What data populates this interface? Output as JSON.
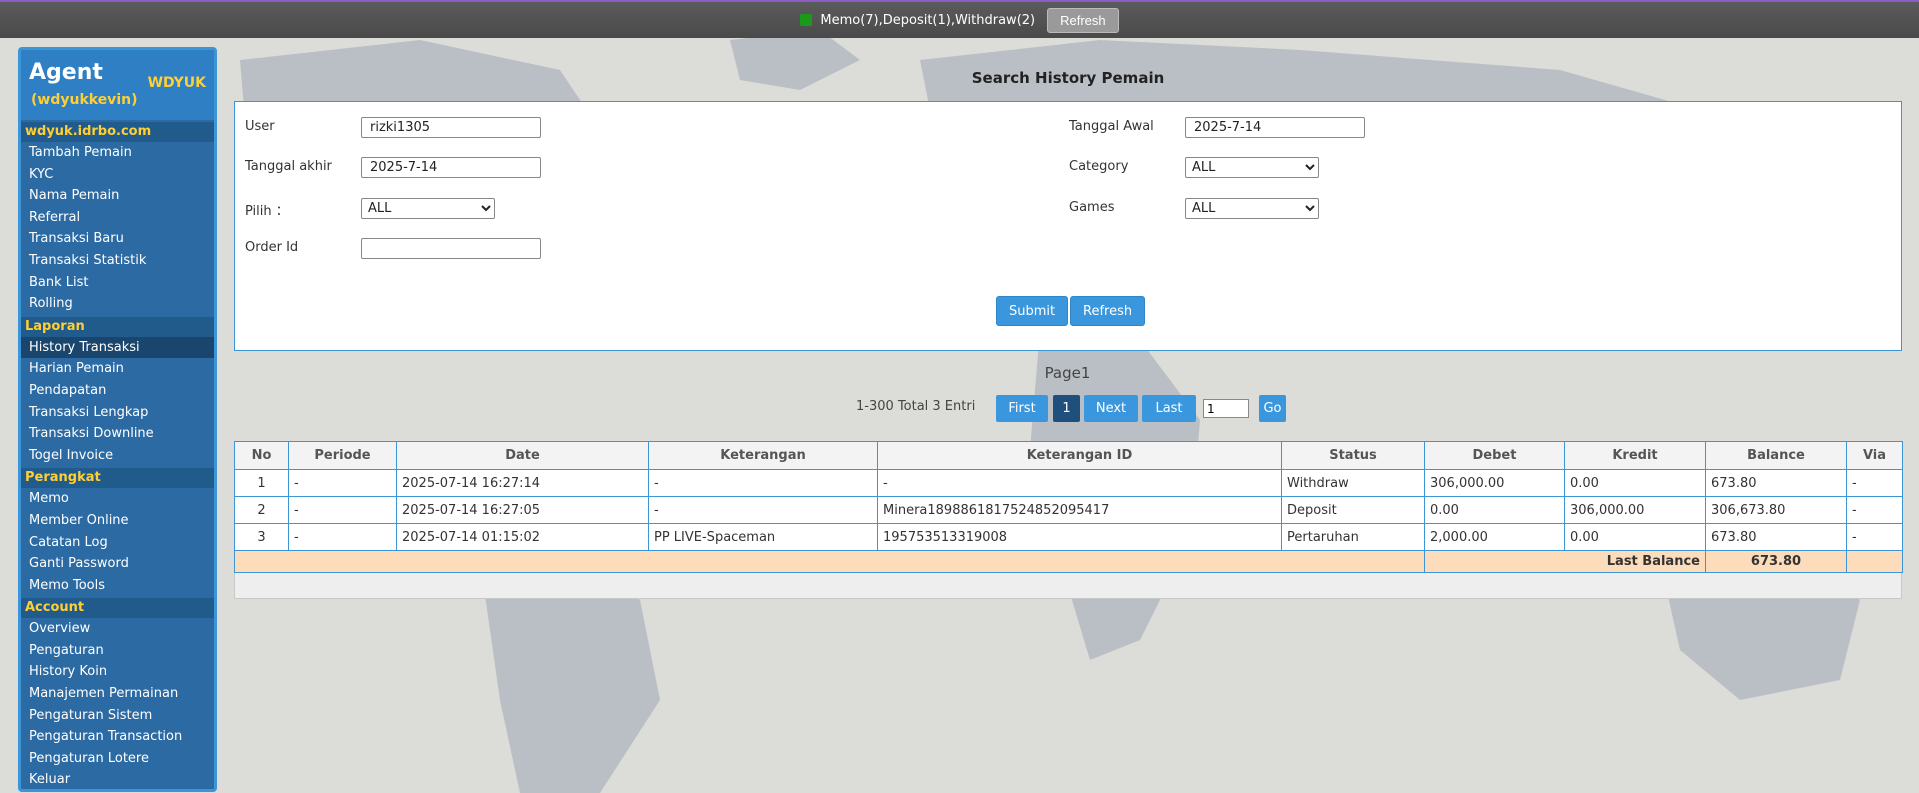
{
  "topbar": {
    "notice": "Memo(7),Deposit(1),Withdraw(2)",
    "refresh_label": "Refresh"
  },
  "sidebar": {
    "agent_title": "Agent",
    "agent_user": "(wdyukkevin)",
    "agent_code": "WDYUK",
    "sections": [
      {
        "heading": "wdyuk.idrbo.com",
        "items": [
          "Tambah Pemain",
          "KYC",
          "Nama Pemain",
          "Referral",
          "Transaksi Baru",
          "Transaksi Statistik",
          "Bank List",
          "Rolling"
        ]
      },
      {
        "heading": "Laporan",
        "items": [
          "History Transaksi",
          "Harian Pemain",
          "Pendapatan",
          "Transaksi Lengkap",
          "Transaksi Downline",
          "Togel Invoice"
        ]
      },
      {
        "heading": "Perangkat",
        "items": [
          "Memo",
          "Member Online",
          "Catatan Log",
          "Ganti Password",
          "Memo Tools"
        ]
      },
      {
        "heading": "Account",
        "items": [
          "Overview",
          "Pengaturan",
          "History Koin",
          "Manajemen Permainan",
          "Pengaturan Sistem",
          "Pengaturan Transaction",
          "Pengaturan Lotere",
          "Keluar"
        ]
      }
    ],
    "active_item": "History Transaksi"
  },
  "search": {
    "title": "Search History Pemain",
    "user_label": "User",
    "user_value": "rizki1305",
    "tanggal_akhir_label": "Tanggal akhir",
    "tanggal_akhir_value": "2025-7-14",
    "pilih_label": "Pilih ：",
    "pilih_value": "ALL",
    "order_id_label": "Order Id",
    "order_id_value": "",
    "tanggal_awal_label": "Tanggal Awal",
    "tanggal_awal_value": "2025-7-14",
    "category_label": "Category",
    "category_value": "ALL",
    "games_label": "Games",
    "games_value": "ALL",
    "submit_label": "Submit",
    "refresh_label": "Refresh"
  },
  "pagination": {
    "page_label": "Page1",
    "entries_text": "1-300 Total 3 Entri",
    "first": "First",
    "current": "1",
    "next": "Next",
    "last": "Last",
    "go_input": "1",
    "go": "Go"
  },
  "table": {
    "headers": [
      "No",
      "Periode",
      "Date",
      "Keterangan",
      "Keterangan ID",
      "Status",
      "Debet",
      "Kredit",
      "Balance",
      "Via"
    ],
    "rows": [
      {
        "no": "1",
        "periode": "-",
        "date": "2025-07-14 16:27:14",
        "keterangan": "-",
        "keterangan_id": "-",
        "status": "Withdraw",
        "debet": "306,000.00",
        "kredit": "0.00",
        "balance": "673.80",
        "via": "-"
      },
      {
        "no": "2",
        "periode": "-",
        "date": "2025-07-14 16:27:05",
        "keterangan": "-",
        "keterangan_id": "Minera1898861817524852095417",
        "status": "Deposit",
        "debet": "0.00",
        "kredit": "306,000.00",
        "balance": "306,673.80",
        "via": "-"
      },
      {
        "no": "3",
        "periode": "-",
        "date": "2025-07-14 01:15:02",
        "keterangan": "PP LIVE-Spaceman",
        "keterangan_id": "195753513319008",
        "status": "Pertaruhan",
        "debet": "2,000.00",
        "kredit": "0.00",
        "balance": "673.80",
        "via": "-"
      }
    ],
    "last_balance_label": "Last Balance",
    "last_balance_value": "673.80"
  },
  "colors": {
    "accent": "#3a97dd",
    "sidebar": "#2c6aa3",
    "sidebar_heading_text": "#ffcf33",
    "debit_red": "#e01010",
    "credit_green": "#208a20",
    "last_balance_bg": "#fcdcbb"
  }
}
